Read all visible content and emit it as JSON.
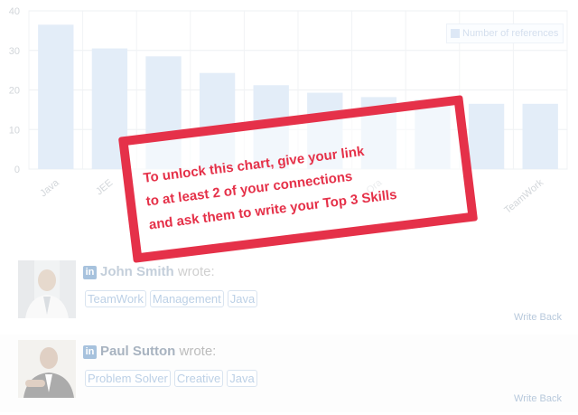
{
  "chart_data": {
    "type": "bar",
    "categories": [
      "Java",
      "JEE",
      "",
      "",
      "",
      "",
      "Ora",
      "",
      "",
      "TeamWork"
    ],
    "values": [
      36.5,
      30.5,
      28.5,
      24.3,
      21.2,
      19.3,
      18.2,
      17.5,
      16.5,
      16.5
    ],
    "legend": "Number of references",
    "legend_position": "top-right",
    "ylim": [
      0,
      40
    ],
    "yticks": [
      "0",
      "10",
      "20",
      "30",
      "40"
    ],
    "grid": true
  },
  "stamp": {
    "lines": [
      "To unlock this chart, give your link",
      "to at least 2 of your connections",
      "and ask them to write your Top 3 Skills"
    ]
  },
  "recommendations": [
    {
      "author": "John Smith",
      "verb": "wrote:",
      "tags": [
        "TeamWork",
        "Management",
        "Java"
      ],
      "write_back": "Write Back"
    },
    {
      "author": "Paul Sutton",
      "verb": "wrote:",
      "tags": [
        "Problem Solver",
        "Creative",
        "Java"
      ],
      "write_back": "Write Back"
    }
  ],
  "icons": {
    "network": "in",
    "avatar_1": "person-photo-icon",
    "avatar_2": "person-photo-icon"
  }
}
